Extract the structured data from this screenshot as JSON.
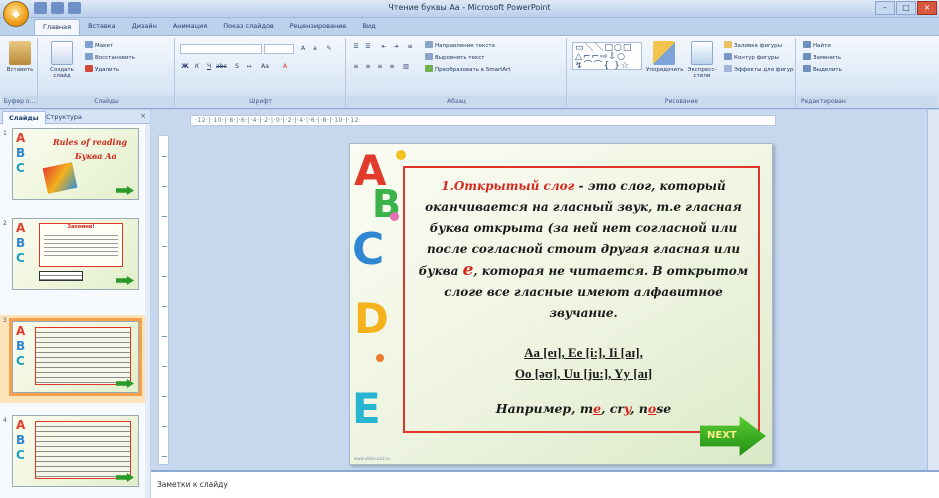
{
  "window": {
    "title": "Чтение буквы Aa - Microsoft PowerPoint",
    "controls": [
      "–",
      "□",
      "×"
    ]
  },
  "ribbon": {
    "tabs": [
      "Главная",
      "Вставка",
      "Дизайн",
      "Анимация",
      "Показ слайдов",
      "Рецензирование",
      "Вид"
    ],
    "groups": {
      "clipboard": {
        "label": "Буфер о...",
        "paste": "Вставить"
      },
      "slides": {
        "label": "Слайды",
        "create": "Создать слайд",
        "layout": "Макет",
        "reset": "Восстановить",
        "delete": "Удалить"
      },
      "font": {
        "label": "Шрифт"
      },
      "paragraph": {
        "label": "Абзац",
        "text_direction": "Направление текста",
        "align_text": "Выровнять текст",
        "smartart": "Преобразовать в SmartArt"
      },
      "drawing": {
        "label": "Рисование",
        "arrange": "Упорядочить",
        "quick_styles": "Экспресс-стили",
        "fill": "Заливка фигуры",
        "outline": "Контур фигуры",
        "effects": "Эффекты для фигур"
      },
      "editing": {
        "label": "Редактирован",
        "find": "Найти",
        "replace": "Заменить",
        "select": "Выделить"
      }
    }
  },
  "left_panel": {
    "tabs": [
      "Слайды",
      "Структура"
    ],
    "close": "×",
    "thumbnails": [
      {
        "num": "1",
        "title": "Rules of reading",
        "subtitle": "Буква Aa"
      },
      {
        "num": "2",
        "title": "Запомни!"
      },
      {
        "num": "3"
      },
      {
        "num": "4"
      }
    ]
  },
  "ruler": {
    "horizontal": "·12·|·10·|·8·|·6·|·4·|·2·|·0·|·2·|·4·|·6·|·8·|·10·|·12·"
  },
  "slide": {
    "letters": [
      "A",
      "B",
      "C",
      "D",
      "E"
    ],
    "number": "1.",
    "term": "Открытый слог",
    "definition_1": " - это  слог, который оканчивается на гласный звук, т.е гласная буква открыта (за ней нет согласной или после согласной стоит другая гласная или буква ",
    "e_letter": "e",
    "definition_2": ", которая не читается. В открытом слоге все гласные имеют алфавитное звучание.",
    "sounds_line1": "Aa [eɪ], Ee [i:], Ii [aɪ],",
    "sounds_line2": "Oo [əʊ], Uu [ju:], Yy [aɪ]",
    "example_label": "Например, ",
    "ex1a": "m",
    "ex1b": "e",
    "ex_sep1": ", ",
    "ex2a": "cr",
    "ex2b": "y",
    "ex_sep2": ", ",
    "ex3a": "n",
    "ex3b": "o",
    "ex3c": "se",
    "next": "NEXT",
    "watermark": "www.slide.ucoz.ru"
  },
  "notes": {
    "placeholder": "Заметки к слайду"
  },
  "colors": {
    "accent_red": "#d8261c",
    "selected_thumb": "#f6a04b",
    "next_green": "#2b9a2a"
  }
}
